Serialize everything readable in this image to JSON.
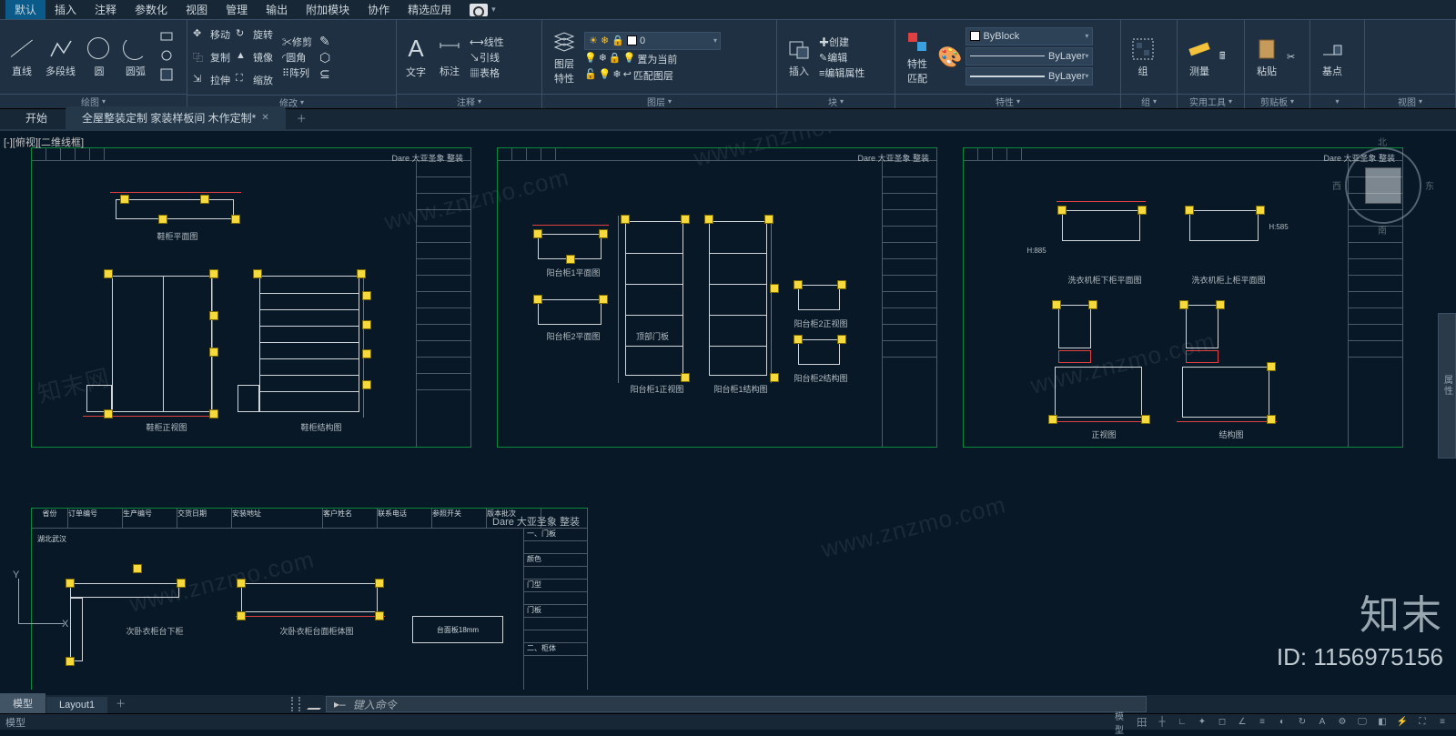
{
  "menu": {
    "items": [
      "默认",
      "插入",
      "注释",
      "参数化",
      "视图",
      "管理",
      "输出",
      "附加模块",
      "协作",
      "精选应用"
    ],
    "active": 0,
    "cam": "▾"
  },
  "ribbon": {
    "draw": {
      "title": "绘图",
      "big": [
        {
          "l": "直线"
        },
        {
          "l": "多段线"
        },
        {
          "l": "圆"
        },
        {
          "l": "圆弧"
        }
      ]
    },
    "modify": {
      "title": "修改",
      "rows": [
        [
          "移动",
          "旋转",
          "修剪"
        ],
        [
          "复制",
          "镜像",
          "圆角"
        ],
        [
          "拉伸",
          "缩放",
          "阵列"
        ]
      ]
    },
    "annot": {
      "title": "注释",
      "big": [
        {
          "l": "文字"
        },
        {
          "l": "标注"
        }
      ],
      "rows": [
        [
          "线性"
        ],
        [
          "引线"
        ],
        [
          "表格"
        ]
      ]
    },
    "layer": {
      "title": "图层",
      "big": "图层\n特性",
      "combo": "0",
      "rows": [
        "置为当前",
        "匹配图层"
      ]
    },
    "block": {
      "title": "块",
      "big": "插入",
      "rows": [
        "创建",
        "编辑",
        "编辑属性"
      ]
    },
    "props": {
      "title": "特性",
      "big": "特性\n匹配",
      "color": "ByBlock",
      "lt": "ByLayer",
      "lw": "ByLayer"
    },
    "group": {
      "title": "组",
      "big": "组"
    },
    "util": {
      "title": "实用工具",
      "big": "测量"
    },
    "clip": {
      "title": "剪贴板",
      "big": "粘贴"
    },
    "base": {
      "title": "基点"
    },
    "view": {
      "title": "视图"
    }
  },
  "filetabs": {
    "start": "开始",
    "doc": "全屋整装定制 家装样板间 木作定制*"
  },
  "viewport": {
    "label": "[-][俯视][二维线框]"
  },
  "sheets": {
    "brand": "Dare 大亚圣象 整装",
    "s1": {
      "captions": [
        "鞋柜平面图",
        "鞋柜正视图",
        "鞋柜结构图"
      ]
    },
    "s2": {
      "captions": [
        "阳台柜1平面图",
        "阳台柜2平面图",
        "顶部门板",
        "阳台柜1正视图",
        "阳台柜1结构图",
        "阳台柜2正视图",
        "阳台柜2结构图"
      ]
    },
    "s3": {
      "captions": [
        "洗衣机柜下柜平面图",
        "洗衣机柜上柜平面图",
        "正视图",
        "结构图"
      ],
      "h": "H:885",
      "h2": "H:585",
      "dir": {
        "w": "西",
        "e": "东",
        "n": "北",
        "s": "南"
      }
    },
    "s4": {
      "header": [
        "省份",
        "订单编号",
        "生产编号",
        "交货日期",
        "安装地址",
        "客户姓名",
        "联系电话",
        "参照开关",
        "版本批次"
      ],
      "prov": "湖北武汉",
      "side": [
        "一、门板",
        "",
        "颜色",
        "",
        "门型",
        "",
        "门板",
        "",
        "",
        "二、柜体"
      ],
      "captions": [
        "次卧衣柜台下柜",
        "次卧衣柜台面柜体图",
        "台面板18mm"
      ]
    }
  },
  "vcube": {
    "w": "西",
    "e": "东",
    "n": "北",
    "s": "南"
  },
  "ucs": {
    "x": "X",
    "y": "Y"
  },
  "cmd": {
    "placeholder": "键入命令"
  },
  "tabs": {
    "model": "模型",
    "layout": "Layout1"
  },
  "status": {
    "model": "模型",
    "left": "模型"
  },
  "watermark": {
    "logo": "知末",
    "id": "ID: 1156975156",
    "url": "www.znzmo.com",
    "cn": "知末网"
  },
  "sidepanel": "属性"
}
